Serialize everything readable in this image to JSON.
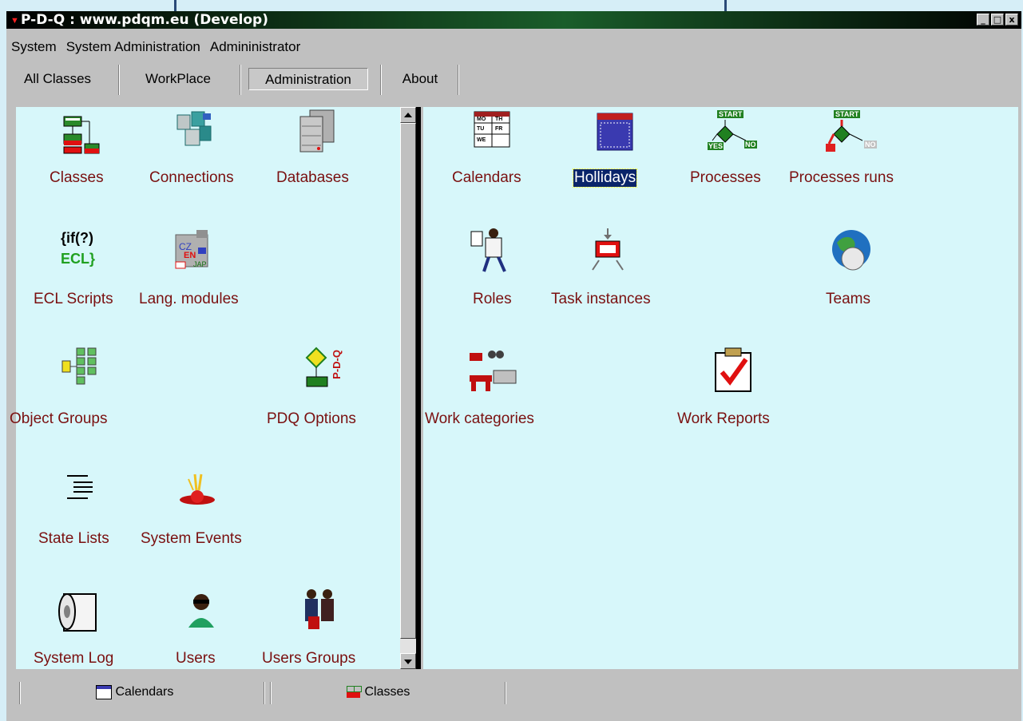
{
  "window": {
    "title": "P-D-Q : www.pdqm.eu (Develop)",
    "controls": [
      "_",
      "□",
      "x"
    ]
  },
  "menu": [
    "System",
    "System Administration",
    "Admininistrator"
  ],
  "tabs": [
    {
      "label": "All Classes",
      "active": false
    },
    {
      "label": "WorkPlace",
      "active": false
    },
    {
      "label": "Administration",
      "active": true
    },
    {
      "label": "About",
      "active": false
    }
  ],
  "left_panel": {
    "items": [
      {
        "label": "Classes",
        "icon": "classes-icon"
      },
      {
        "label": "Connections",
        "icon": "connections-icon"
      },
      {
        "label": "Databases",
        "icon": "databases-icon"
      },
      {
        "label": "ECL Scripts",
        "icon": "ecl-scripts-icon"
      },
      {
        "label": "Lang. modules",
        "icon": "lang-modules-icon"
      },
      {
        "label": "Object Groups",
        "icon": "object-groups-icon"
      },
      {
        "label": "PDQ Options",
        "icon": "pdq-options-icon"
      },
      {
        "label": "State Lists",
        "icon": "state-lists-icon"
      },
      {
        "label": "System Events",
        "icon": "system-events-icon"
      },
      {
        "label": "System Log",
        "icon": "system-log-icon"
      },
      {
        "label": "Users",
        "icon": "users-icon"
      },
      {
        "label": "Users Groups",
        "icon": "users-groups-icon"
      }
    ],
    "icon_texts": {
      "ecl_top": "{if(?)",
      "ecl_bottom": "ECL}",
      "lang_cz": "CZ",
      "lang_en": "EN",
      "lang_jap": "JAP",
      "pdq_vertical": "P-D-Q"
    }
  },
  "right_panel": {
    "items": [
      {
        "label": "Calendars",
        "icon": "calendars-icon"
      },
      {
        "label": "Hollidays",
        "icon": "hollidays-icon",
        "selected": true
      },
      {
        "label": "Processes",
        "icon": "processes-icon"
      },
      {
        "label": "Processes runs",
        "icon": "processes-runs-icon"
      },
      {
        "label": "Roles",
        "icon": "roles-icon"
      },
      {
        "label": "Task instances",
        "icon": "task-instances-icon"
      },
      {
        "label": "Teams",
        "icon": "teams-icon"
      },
      {
        "label": "Work categories",
        "icon": "work-categories-icon"
      },
      {
        "label": "Work Reports",
        "icon": "work-reports-icon"
      }
    ],
    "icon_texts": {
      "cal_mo": "MO",
      "cal_th": "TH",
      "cal_tu": "TU",
      "cal_fr": "FR",
      "cal_we": "WE",
      "start": "START",
      "yes": "YES",
      "no": "NO"
    }
  },
  "statusbar": {
    "cells": [
      {
        "label": "Calendars",
        "icon": "calendars-small-icon"
      },
      {
        "label": "Classes",
        "icon": "classes-small-icon"
      }
    ]
  },
  "colors": {
    "panel_bg": "#d7f7fa",
    "label": "#7a1010",
    "selection": "#0a246a",
    "desktop": "#d6eef7"
  }
}
